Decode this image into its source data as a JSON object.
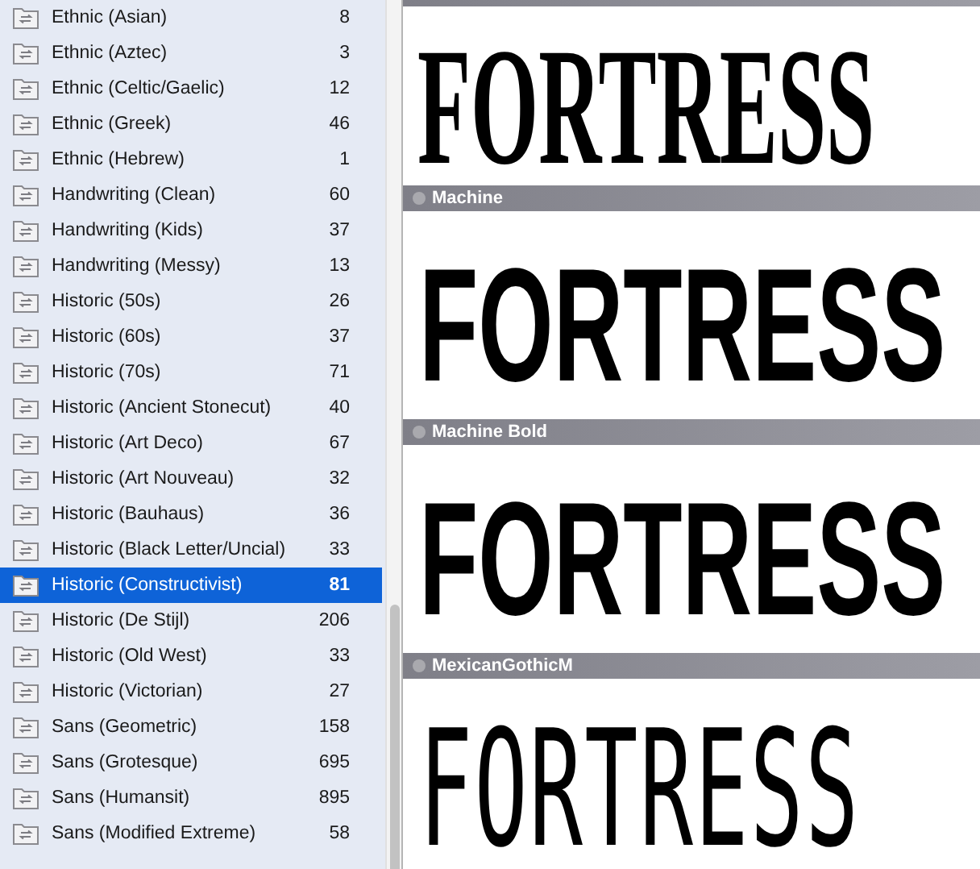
{
  "sidebar": {
    "items": [
      {
        "label": "Ethnic (Asian)",
        "count": "8",
        "selected": false
      },
      {
        "label": "Ethnic (Aztec)",
        "count": "3",
        "selected": false
      },
      {
        "label": "Ethnic (Celtic/Gaelic)",
        "count": "12",
        "selected": false
      },
      {
        "label": "Ethnic (Greek)",
        "count": "46",
        "selected": false
      },
      {
        "label": "Ethnic (Hebrew)",
        "count": "1",
        "selected": false
      },
      {
        "label": "Handwriting (Clean)",
        "count": "60",
        "selected": false
      },
      {
        "label": "Handwriting (Kids)",
        "count": "37",
        "selected": false
      },
      {
        "label": "Handwriting (Messy)",
        "count": "13",
        "selected": false
      },
      {
        "label": "Historic (50s)",
        "count": "26",
        "selected": false
      },
      {
        "label": "Historic (60s)",
        "count": "37",
        "selected": false
      },
      {
        "label": "Historic (70s)",
        "count": "71",
        "selected": false
      },
      {
        "label": "Historic (Ancient Stonecut)",
        "count": "40",
        "selected": false
      },
      {
        "label": "Historic (Art Deco)",
        "count": "67",
        "selected": false
      },
      {
        "label": "Historic (Art Nouveau)",
        "count": "32",
        "selected": false
      },
      {
        "label": "Historic (Bauhaus)",
        "count": "36",
        "selected": false
      },
      {
        "label": "Historic (Black Letter/Uncial)",
        "count": "33",
        "selected": false
      },
      {
        "label": "Historic (Constructivist)",
        "count": "81",
        "selected": true
      },
      {
        "label": "Historic (De Stijl)",
        "count": "206",
        "selected": false
      },
      {
        "label": "Historic (Old West)",
        "count": "33",
        "selected": false
      },
      {
        "label": "Historic (Victorian)",
        "count": "27",
        "selected": false
      },
      {
        "label": "Sans (Geometric)",
        "count": "158",
        "selected": false
      },
      {
        "label": "Sans (Grotesque)",
        "count": "695",
        "selected": false
      },
      {
        "label": "Sans (Humansit)",
        "count": "895",
        "selected": false
      },
      {
        "label": "Sans (Modified Extreme)",
        "count": "58",
        "selected": false
      }
    ]
  },
  "previews": [
    {
      "sample": "FORTRESS",
      "kind": "condensed-serif"
    },
    {
      "name": "Machine",
      "sample": "FORTRESS",
      "kind": "heavy"
    },
    {
      "name": "Machine Bold",
      "sample": "FORTRESS",
      "kind": "heavy"
    },
    {
      "name": "MexicanGothicM",
      "sample": "FORTRESS",
      "kind": "thin-gothic"
    }
  ]
}
